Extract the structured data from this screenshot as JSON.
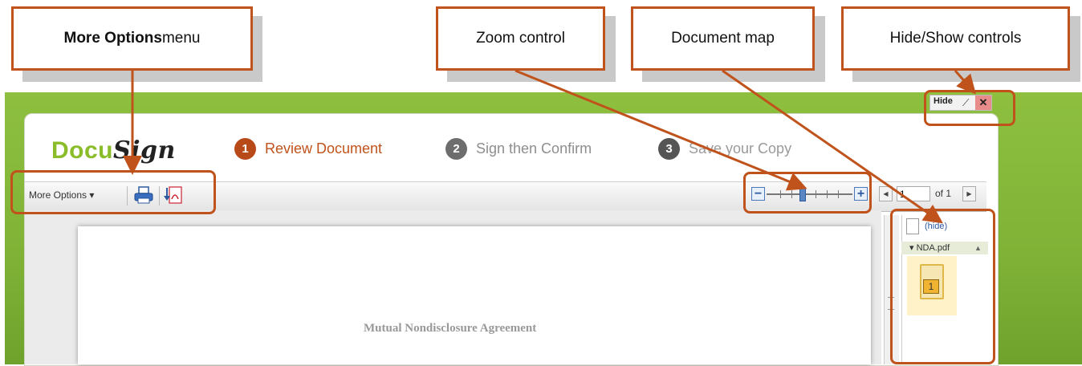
{
  "callouts": {
    "more_options": {
      "bold": "More Options",
      "rest": " menu"
    },
    "zoom": "Zoom control",
    "doc_map": "Document map",
    "hide_show": "Hide/Show controls"
  },
  "app": {
    "logo": {
      "docu": "Docu",
      "sign": "Sign"
    },
    "steps": [
      {
        "num": "1",
        "label": "Review Document"
      },
      {
        "num": "2",
        "label": "Sign then Confirm"
      },
      {
        "num": "3",
        "label": "Save your Copy"
      }
    ],
    "toolbar": {
      "more_options_label": "More Options ▾",
      "page_value": "1",
      "page_of": "of 1"
    },
    "doc_title": "Mutual Nondisclosure Agreement",
    "map": {
      "hide_label": "(hide)",
      "file_label": "▾ NDA.pdf",
      "thumb_page": "1"
    },
    "hide_control": {
      "label": "Hide",
      "close": "✕"
    }
  },
  "colors": {
    "callout_border": "#c0531c",
    "frame_green": "#7fb236",
    "step_active": "#c0531c"
  }
}
